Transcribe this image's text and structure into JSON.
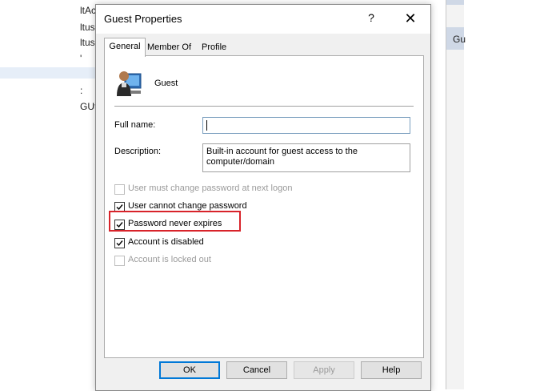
{
  "background": {
    "left_fragments": [
      "ltAc",
      "ltus",
      "ltus",
      "'",
      ":",
      "GUti"
    ],
    "right_label": "Gu"
  },
  "dialog": {
    "title": "Guest Properties",
    "help_glyph": "?",
    "close_glyph": "✕",
    "tabs": [
      {
        "label": "General",
        "active": true
      },
      {
        "label": "Member Of",
        "active": false
      },
      {
        "label": "Profile",
        "active": false
      }
    ],
    "user": {
      "icon": "user-account-icon",
      "name": "Guest"
    },
    "fields": {
      "full_name_label": "Full name:",
      "full_name_value": "",
      "description_label": "Description:",
      "description_value": "Built-in account for guest access to the computer/domain"
    },
    "checkboxes": [
      {
        "label": "User must change password at next logon",
        "checked": false,
        "enabled": false
      },
      {
        "label": "User cannot change password",
        "checked": true,
        "enabled": true
      },
      {
        "label": "Password never expires",
        "checked": true,
        "enabled": true
      },
      {
        "label": "Account is disabled",
        "checked": true,
        "enabled": true
      },
      {
        "label": "Account is locked out",
        "checked": false,
        "enabled": false
      }
    ],
    "buttons": {
      "ok": "OK",
      "cancel": "Cancel",
      "apply": "Apply",
      "help": "Help"
    },
    "colors": {
      "highlight": "#d8232a",
      "default_button_border": "#0078d7"
    }
  }
}
